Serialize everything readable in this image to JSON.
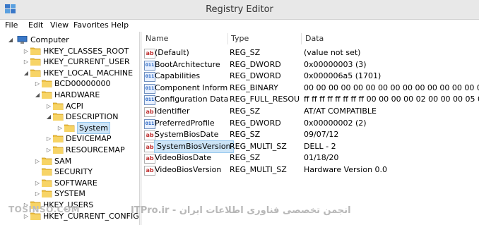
{
  "window": {
    "title": "Registry Editor"
  },
  "menu": [
    "File",
    "Edit",
    "View",
    "Favorites",
    "Help"
  ],
  "tree": [
    {
      "label": "Computer",
      "level": 0,
      "expanded": true,
      "icon": "computer-icon"
    },
    {
      "label": "HKEY_CLASSES_ROOT",
      "level": 1,
      "expanded": false
    },
    {
      "label": "HKEY_CURRENT_USER",
      "level": 1,
      "expanded": false
    },
    {
      "label": "HKEY_LOCAL_MACHINE",
      "level": 1,
      "expanded": true
    },
    {
      "label": "BCD00000000",
      "level": 2,
      "expanded": false
    },
    {
      "label": "HARDWARE",
      "level": 2,
      "expanded": true
    },
    {
      "label": "ACPI",
      "level": 3,
      "expanded": false
    },
    {
      "label": "DESCRIPTION",
      "level": 3,
      "expanded": true
    },
    {
      "label": "System",
      "level": 4,
      "expanded": false,
      "selected": true
    },
    {
      "label": "DEVICEMAP",
      "level": 3,
      "expanded": false
    },
    {
      "label": "RESOURCEMAP",
      "level": 3,
      "expanded": false
    },
    {
      "label": "SAM",
      "level": 2,
      "expanded": false
    },
    {
      "label": "SECURITY",
      "level": 2,
      "expanded": null
    },
    {
      "label": "SOFTWARE",
      "level": 2,
      "expanded": false
    },
    {
      "label": "SYSTEM",
      "level": 2,
      "expanded": false
    },
    {
      "label": "HKEY_USERS",
      "level": 1,
      "expanded": false
    },
    {
      "label": "HKEY_CURRENT_CONFIG",
      "level": 1,
      "expanded": false
    }
  ],
  "columns": {
    "name": "Name",
    "type": "Type",
    "data": "Data"
  },
  "values": [
    {
      "name": "(Default)",
      "type": "REG_SZ",
      "data": "(value not set)",
      "icon": "ab"
    },
    {
      "name": "BootArchitecture",
      "type": "REG_DWORD",
      "data": "0x00000003 (3)",
      "icon": "bin"
    },
    {
      "name": "Capabilities",
      "type": "REG_DWORD",
      "data": "0x000006a5 (1701)",
      "icon": "bin"
    },
    {
      "name": "Component Inform...",
      "type": "REG_BINARY",
      "data": "00 00 00 00 00 00 00 00 00 00 00 00 00 00 00 00",
      "icon": "bin"
    },
    {
      "name": "Configuration Data",
      "type": "REG_FULL_RESOU...",
      "data": "ff ff ff ff ff ff ff ff 00 00 00 00 02 00 00 00 05 00 00 00 ...",
      "icon": "bin"
    },
    {
      "name": "Identifier",
      "type": "REG_SZ",
      "data": "AT/AT COMPATIBLE",
      "icon": "ab"
    },
    {
      "name": "PreferredProfile",
      "type": "REG_DWORD",
      "data": "0x00000002 (2)",
      "icon": "bin"
    },
    {
      "name": "SystemBiosDate",
      "type": "REG_SZ",
      "data": "09/07/12",
      "icon": "ab"
    },
    {
      "name": "SystemBiosVersion",
      "type": "REG_MULTI_SZ",
      "data": "DELL   - 2",
      "icon": "ab",
      "selected": true
    },
    {
      "name": "VideoBiosDate",
      "type": "REG_SZ",
      "data": "01/18/20",
      "icon": "ab"
    },
    {
      "name": "VideoBiosVersion",
      "type": "REG_MULTI_SZ",
      "data": "Hardware Version 0.0",
      "icon": "ab"
    }
  ],
  "watermark": {
    "left": "TOSINSO.COM",
    "main": "ITPro.ir - انجمن تخصصی فناوری اطلاعات ایران"
  },
  "colors": {
    "selection": "#cce4f7",
    "folder": "#f0c040",
    "titlebar": "#e8e8e8"
  }
}
